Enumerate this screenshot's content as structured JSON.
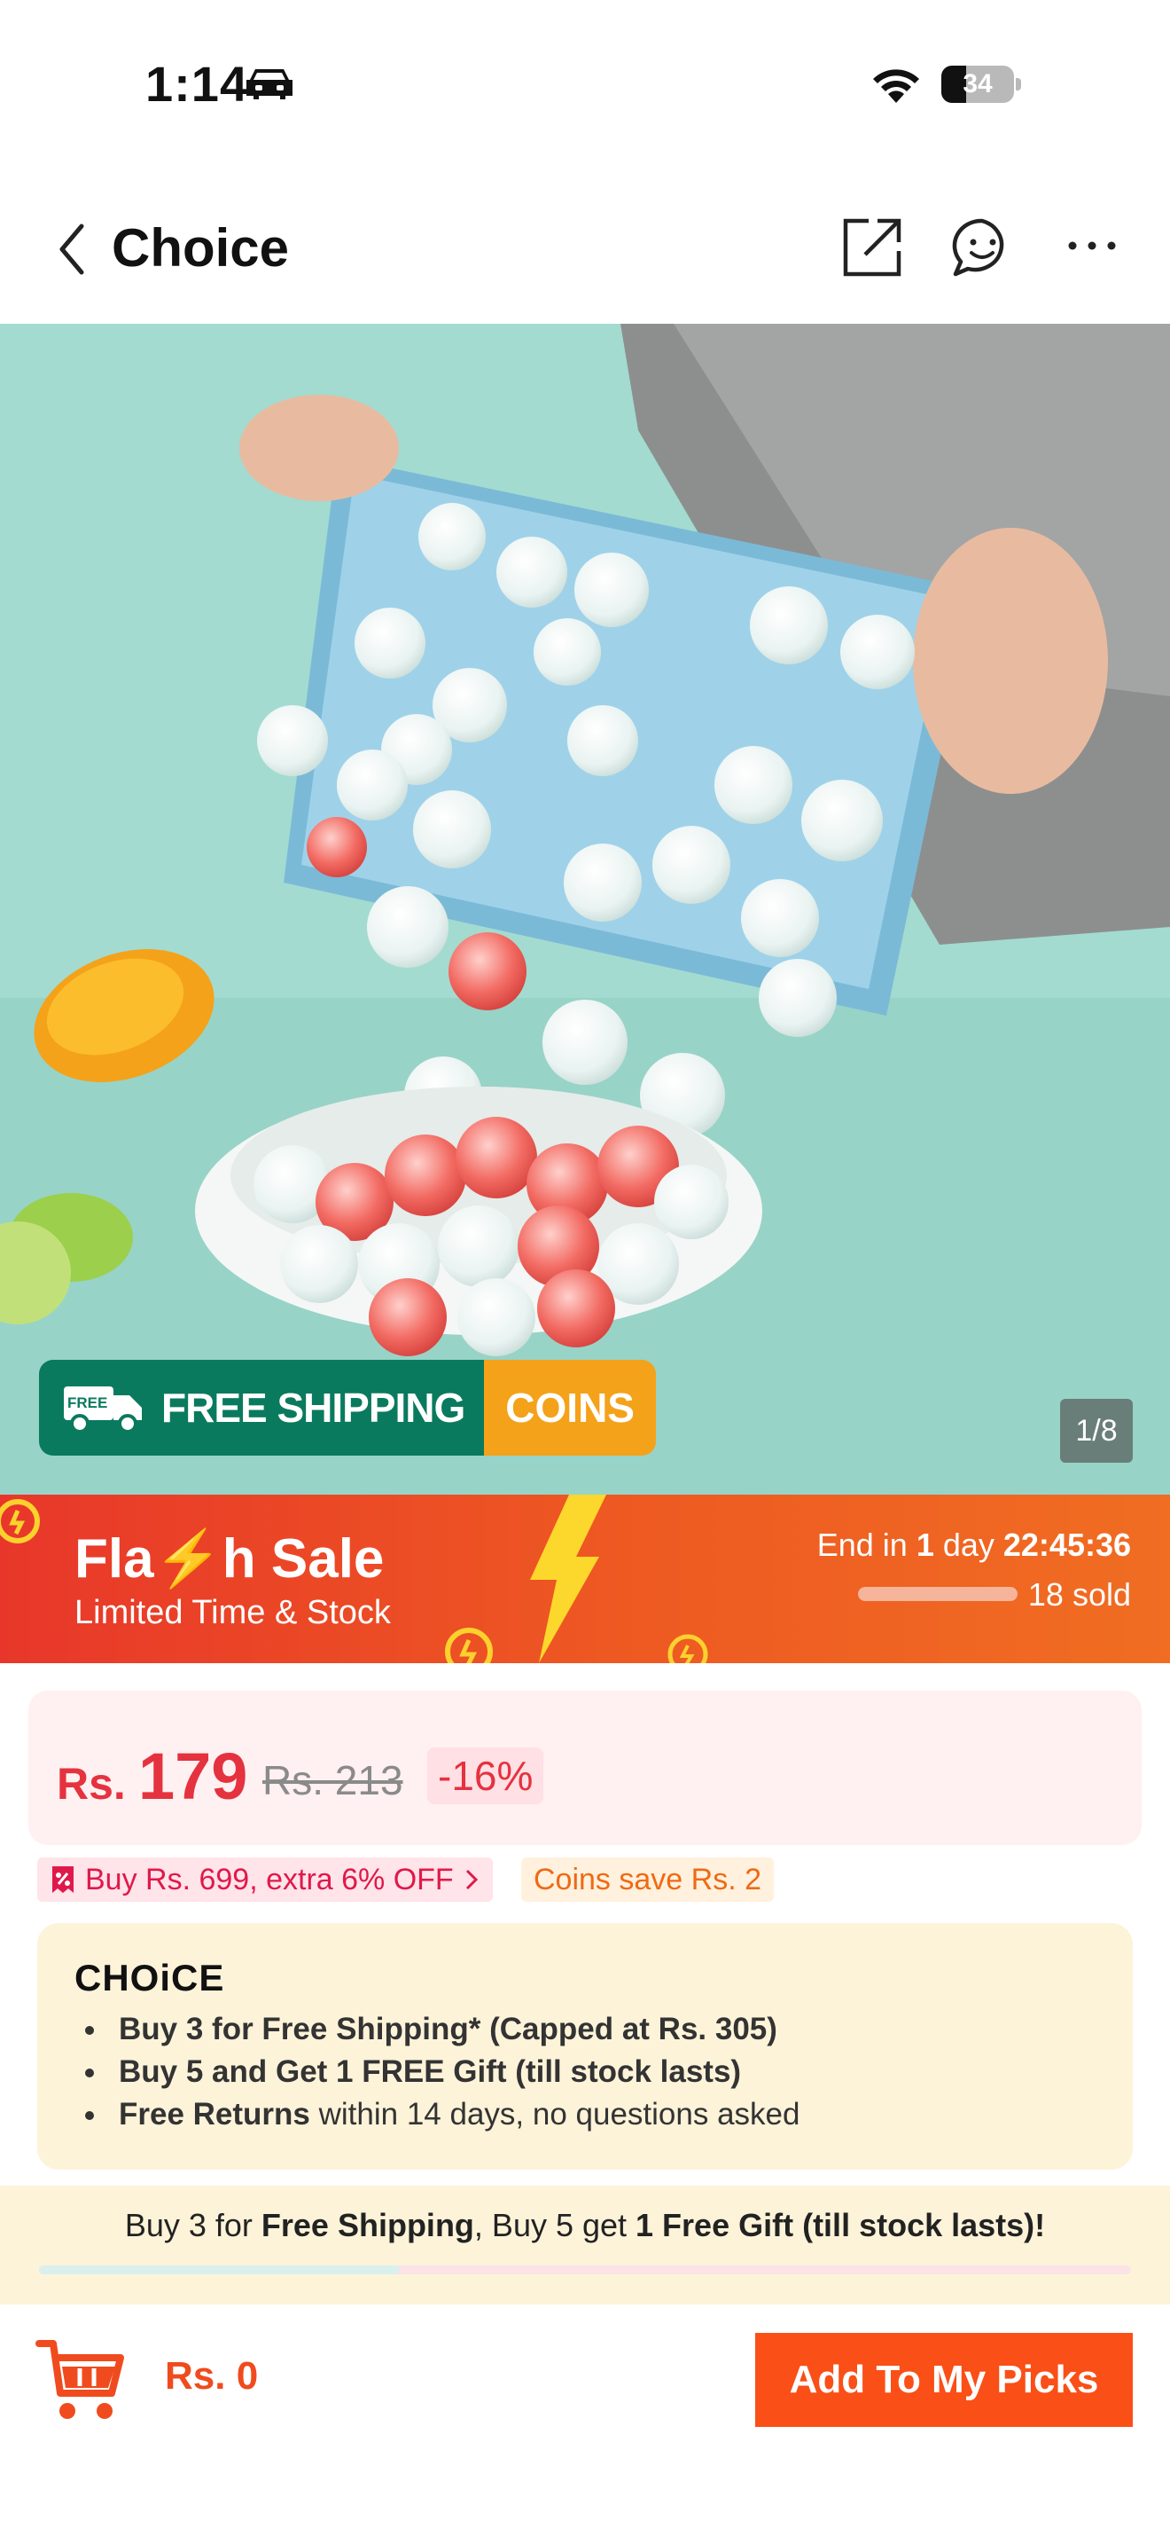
{
  "status_bar": {
    "time": "1:14",
    "battery": "34",
    "battery_level": 0.34
  },
  "nav": {
    "title": "Choice"
  },
  "hero": {
    "badge_shipping": "FREE SHIPPING",
    "badge_coins": "COINS",
    "badge_free_mini": "FREE",
    "counter": "1/8"
  },
  "flash_sale": {
    "title": "Fla⚡h Sale",
    "subtitle": "Limited Time & Stock",
    "end_prefix": "End in ",
    "end_days": "1",
    "end_unit": " day ",
    "end_time": "22:45:36",
    "sold": "18 sold",
    "sold_fraction": 0.6
  },
  "price": {
    "currency": "Rs.",
    "value": "179",
    "old": "Rs. 213",
    "discount": "-16%"
  },
  "promos": {
    "bundle_offer": "Buy Rs. 699, extra 6% OFF",
    "coins": "Coins save Rs. 2"
  },
  "choice": {
    "logo": "CHOiCE",
    "item1": "Buy 3 for  Free Shipping* (Capped at Rs. 305)",
    "item2": "Buy 5 and Get 1 FREE Gift (till stock lasts)",
    "item3_bold": "Free Returns",
    "item3_rest": " within 14 days, no questions asked"
  },
  "bundle": {
    "part1": "Buy 3 for ",
    "part2": "Free Shipping",
    "part3": ", Buy 5 get ",
    "part4": "1 Free Gift (till stock lasts)!",
    "progress": 0.33
  },
  "bottom_bar": {
    "cart_total": "Rs. 0",
    "add_button": "Add To My Picks"
  },
  "colors": {
    "accent": "#fa4f17",
    "price_red": "#e5323f",
    "shipping_green": "#0a7a5e",
    "coins_orange": "#f4a21a"
  }
}
